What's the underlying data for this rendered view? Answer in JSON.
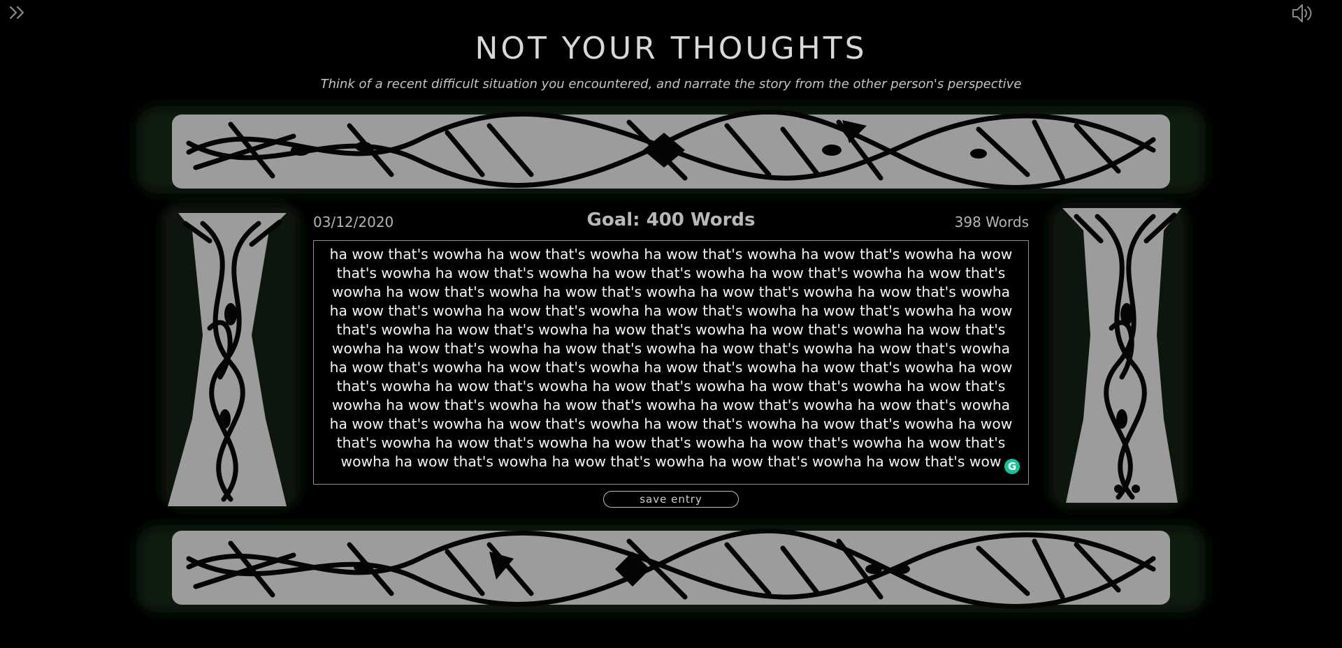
{
  "header": {
    "title": "NOT YOUr THOUGHTS",
    "prompt": "Think of a recent difficult situation you encountered, and narrate the story from the other person's perspective"
  },
  "icons": {
    "expand": "double-chevron-right-icon",
    "sound": "speaker-volume-icon",
    "grammarly": "grammarly-icon"
  },
  "entry": {
    "date": "03/12/2020",
    "goal_label": "Goal: 400 Words",
    "word_count_label": "398 Words",
    "text": "ha wow that's wowha ha wow that's wowha ha wow that's wowha ha wow that's wowha ha wow that's wowha ha wow that's wowha ha wow that's wowha ha wow that's wowha ha wow that's wowha ha wow that's wowha ha wow that's wowha ha wow that's wowha ha wow that's wowha ha wow that's wowha ha wow that's wowha ha wow that's wowha ha wow that's wowha ha wow that's wowha ha wow that's wowha ha wow that's wowha ha wow that's wowha ha wow that's wowha ha wow that's wowha ha wow that's wowha ha wow that's wowha ha wow that's wowha ha wow that's wowha ha wow that's wowha ha wow that's wowha ha wow that's wowha ha wow that's wowha ha wow that's wowha ha wow that's wowha ha wow that's wowha ha wow that's wowha ha wow that's wowha ha wow that's wowha ha wow that's wowha ha wow that's wowha ha wow that's wowha ha wow that's wowha ha wow that's wowha ha wow that's wowha ha wow that's wowha ha wow that's wowha ha wow that's wowha ha wow that's wowha ha wow that's wowha ha wow that's wowha ha wow that's wowha ha wow that's wowha ha wow that's wowha ha wow that's wowha ha wow that's wowha ha wow that's wowha ha wow that's wowha ha wow that's wowha ha wow that's wowha ha wow that's wowha ha wow that's wowha ha wow that's wowha ha wow that's wowha ha wow that's wowha ha wow that's wowha ha wow that's wow",
    "grammarly_glyph": "G"
  },
  "actions": {
    "save_label": "save entry"
  },
  "colors": {
    "background": "#000000",
    "frame_fill": "#a9a9a9",
    "frame_glow": "#10180f",
    "text": "#f4f4f4",
    "grammarly": "#15c39a"
  }
}
